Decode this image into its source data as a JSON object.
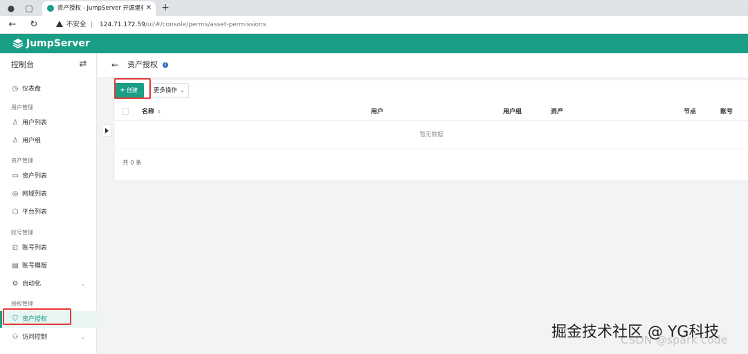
{
  "browser": {
    "tab_title": "资产授权 - JumpServer 开源堡垒",
    "insecure_label": "不安全",
    "url_host": "124.71.172.59",
    "url_path": "/ui/#/console/perms/asset-permissions"
  },
  "app": {
    "logo_text": "JumpServer",
    "brand_color": "#1a9e86"
  },
  "sidebar": {
    "title": "控制台",
    "items": [
      {
        "label": "仪表盘",
        "icon": "dashboard-icon"
      },
      {
        "group": "用户管理"
      },
      {
        "label": "用户列表",
        "icon": "user-icon"
      },
      {
        "label": "用户组",
        "icon": "users-icon"
      },
      {
        "group": "资产管理"
      },
      {
        "label": "资产列表",
        "icon": "monitor-icon"
      },
      {
        "label": "网域列表",
        "icon": "location-icon"
      },
      {
        "label": "平台列表",
        "icon": "cube-icon"
      },
      {
        "group": "账号管理"
      },
      {
        "label": "账号列表",
        "icon": "lock-icon"
      },
      {
        "label": "账号模版",
        "icon": "template-icon"
      },
      {
        "label": "自动化",
        "icon": "gear-icon"
      },
      {
        "group": "授权管理"
      },
      {
        "label": "资产授权",
        "icon": "shield-icon",
        "active": true
      },
      {
        "label": "访问控制",
        "icon": "access-icon"
      }
    ]
  },
  "page": {
    "title": "资产授权",
    "create_label": "创建",
    "more_label": "更多操作",
    "columns": [
      "名称",
      "用户",
      "用户组",
      "资产",
      "节点",
      "账号"
    ],
    "empty_text": "暂无数据",
    "total_text": "共 0 条"
  },
  "watermark": {
    "text": "掘金技术社区 @ YG科技",
    "csdn": "CSDN @spark code"
  }
}
